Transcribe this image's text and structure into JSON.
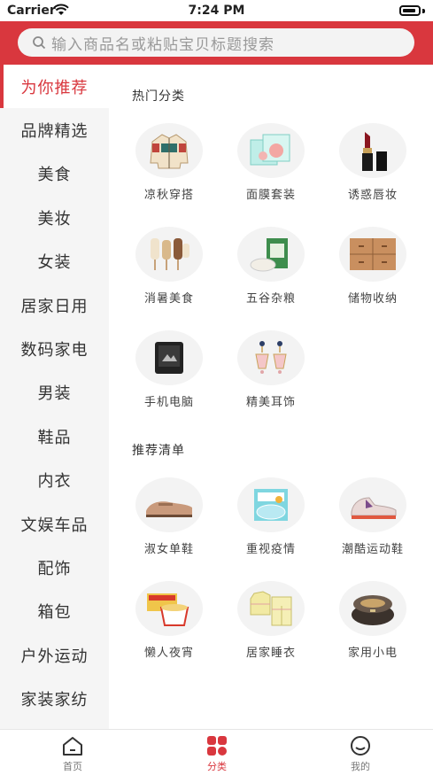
{
  "status_bar": {
    "carrier": "Carrier",
    "time": "7:24 PM"
  },
  "search": {
    "placeholder": "输入商品名或粘贴宝贝标题搜索"
  },
  "sidebar": {
    "items": [
      {
        "label": "为你推荐",
        "active": true
      },
      {
        "label": "品牌精选"
      },
      {
        "label": "美食"
      },
      {
        "label": "美妆"
      },
      {
        "label": "女装"
      },
      {
        "label": "居家日用"
      },
      {
        "label": "数码家电"
      },
      {
        "label": "男装"
      },
      {
        "label": "鞋品"
      },
      {
        "label": "内衣"
      },
      {
        "label": "文娱车品"
      },
      {
        "label": "配饰"
      },
      {
        "label": "箱包"
      },
      {
        "label": "户外运动"
      },
      {
        "label": "家装家纺"
      }
    ]
  },
  "hot_categories": {
    "title": "热门分类",
    "items": [
      {
        "label": "凉秋穿搭",
        "icon": "jacket-icon"
      },
      {
        "label": "面膜套装",
        "icon": "face-mask-icon"
      },
      {
        "label": "诱惑唇妆",
        "icon": "lipstick-icon"
      },
      {
        "label": "消暑美食",
        "icon": "popsicle-icon"
      },
      {
        "label": "五谷杂粮",
        "icon": "grain-bag-icon"
      },
      {
        "label": "储物收纳",
        "icon": "drawer-icon"
      },
      {
        "label": "手机电脑",
        "icon": "phone-icon"
      },
      {
        "label": "精美耳饰",
        "icon": "earrings-icon"
      }
    ]
  },
  "recommended": {
    "title": "推荐清单",
    "items": [
      {
        "label": "淑女单鞋",
        "icon": "loafer-icon"
      },
      {
        "label": "重视疫情",
        "icon": "mask-box-icon"
      },
      {
        "label": "潮酷运动鞋",
        "icon": "sneaker-icon"
      },
      {
        "label": "懒人夜宵",
        "icon": "noodles-icon"
      },
      {
        "label": "居家睡衣",
        "icon": "pajamas-icon"
      },
      {
        "label": "家用小电",
        "icon": "rice-cooker-icon"
      }
    ]
  },
  "tabbar": {
    "items": [
      {
        "label": "首页",
        "icon": "home-icon"
      },
      {
        "label": "分类",
        "icon": "category-icon",
        "active": true
      },
      {
        "label": "我的",
        "icon": "profile-icon"
      }
    ]
  },
  "colors": {
    "accent": "#d9373e",
    "sidebar_bg": "#f5f5f5"
  }
}
